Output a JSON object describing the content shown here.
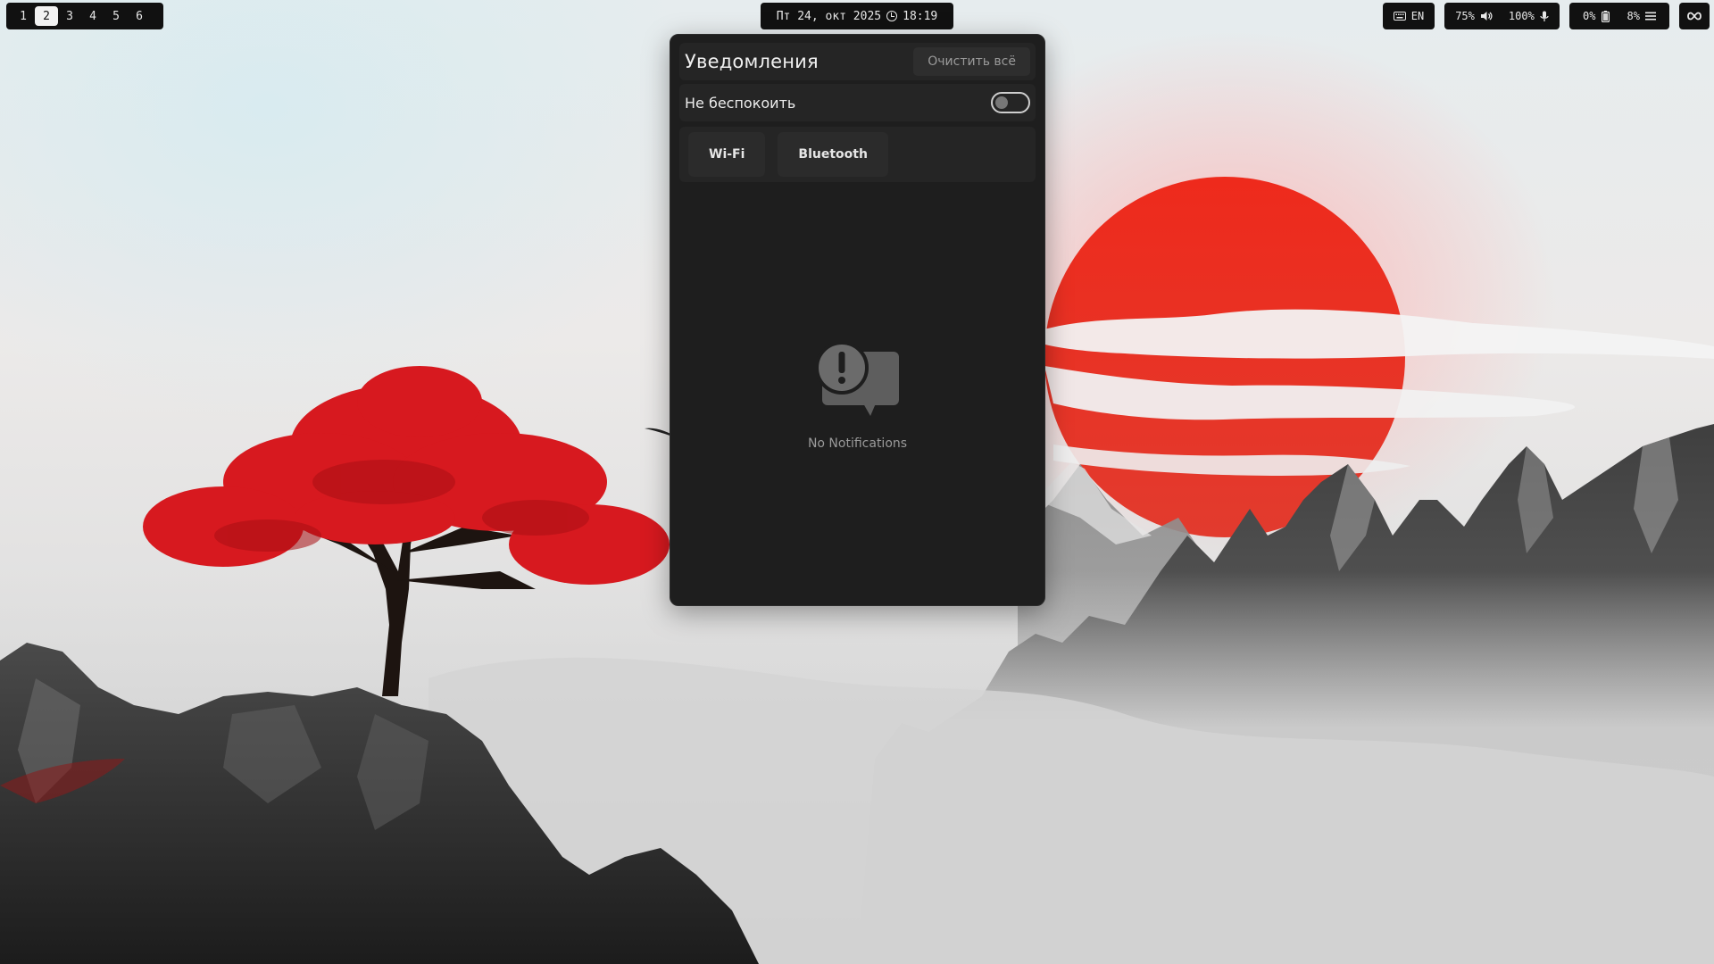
{
  "topbar": {
    "workspaces": [
      "1",
      "2",
      "3",
      "4",
      "5",
      "6"
    ],
    "active_workspace": "2",
    "clock": {
      "date": "Пт 24, окт 2025",
      "time": "18:19"
    },
    "keyboard": {
      "icon": "keyboard-icon",
      "layout": "EN"
    },
    "audio": {
      "volume": "75%",
      "volume_icon": "speaker-icon",
      "mic": "100%",
      "mic_icon": "microphone-icon"
    },
    "system": {
      "battery": "0%",
      "battery_icon": "battery-icon",
      "cpu": "8%",
      "menu_icon": "menu-icon"
    },
    "extra_icon": "infinity-icon"
  },
  "notifications": {
    "title": "Уведомления",
    "clear_all": "Очистить всё",
    "dnd_label": "Не беспокоить",
    "dnd_enabled": false,
    "quick_toggles": [
      "Wi-Fi",
      "Bluetooth"
    ],
    "empty_icon": "alert-chat-icon",
    "empty_text": "No Notifications"
  },
  "colors": {
    "bar_bg": "#111111",
    "panel_bg": "#1e1e1e",
    "panel_section": "#252525",
    "sun": "#e8231a",
    "tree": "#d7191f"
  }
}
